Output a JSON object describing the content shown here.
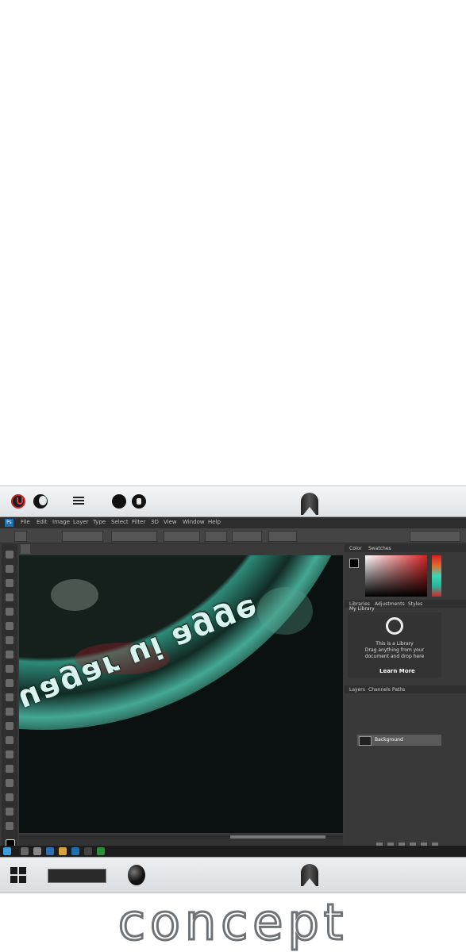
{
  "top_bar": {
    "icons": [
      "power-icon",
      "moon-icon",
      "menu-icon",
      "circle-icon",
      "lock-icon",
      "bookmark-icon"
    ]
  },
  "photoshop": {
    "app_logo": "Ps",
    "menu": [
      "File",
      "Edit",
      "Image",
      "Layer",
      "Type",
      "Select",
      "Filter",
      "3D",
      "View",
      "Window",
      "Help"
    ],
    "canvas_text": "uagar ui agge",
    "panels": {
      "color_tabs": [
        "Color",
        "Swatches"
      ],
      "library_tabs": [
        "Libraries",
        "Adjustments",
        "Styles"
      ],
      "library_name": "My Library",
      "library_message_1": "This is a Library",
      "library_message_2": "Drag anything from your",
      "library_message_3": "document and drop here",
      "learn_more": "Learn More",
      "layers_tabs": [
        "Layers",
        "Channels",
        "Paths"
      ],
      "layer_name": "Background"
    },
    "colors": {
      "accent": "#3ea893",
      "panel_bg": "#393939",
      "foreground": "#000000"
    }
  },
  "bottom_bar": {
    "icons": [
      "windows-icon",
      "search-box",
      "egg-button-icon",
      "bookmark-icon"
    ]
  },
  "brand": {
    "wordmark": "concept"
  }
}
